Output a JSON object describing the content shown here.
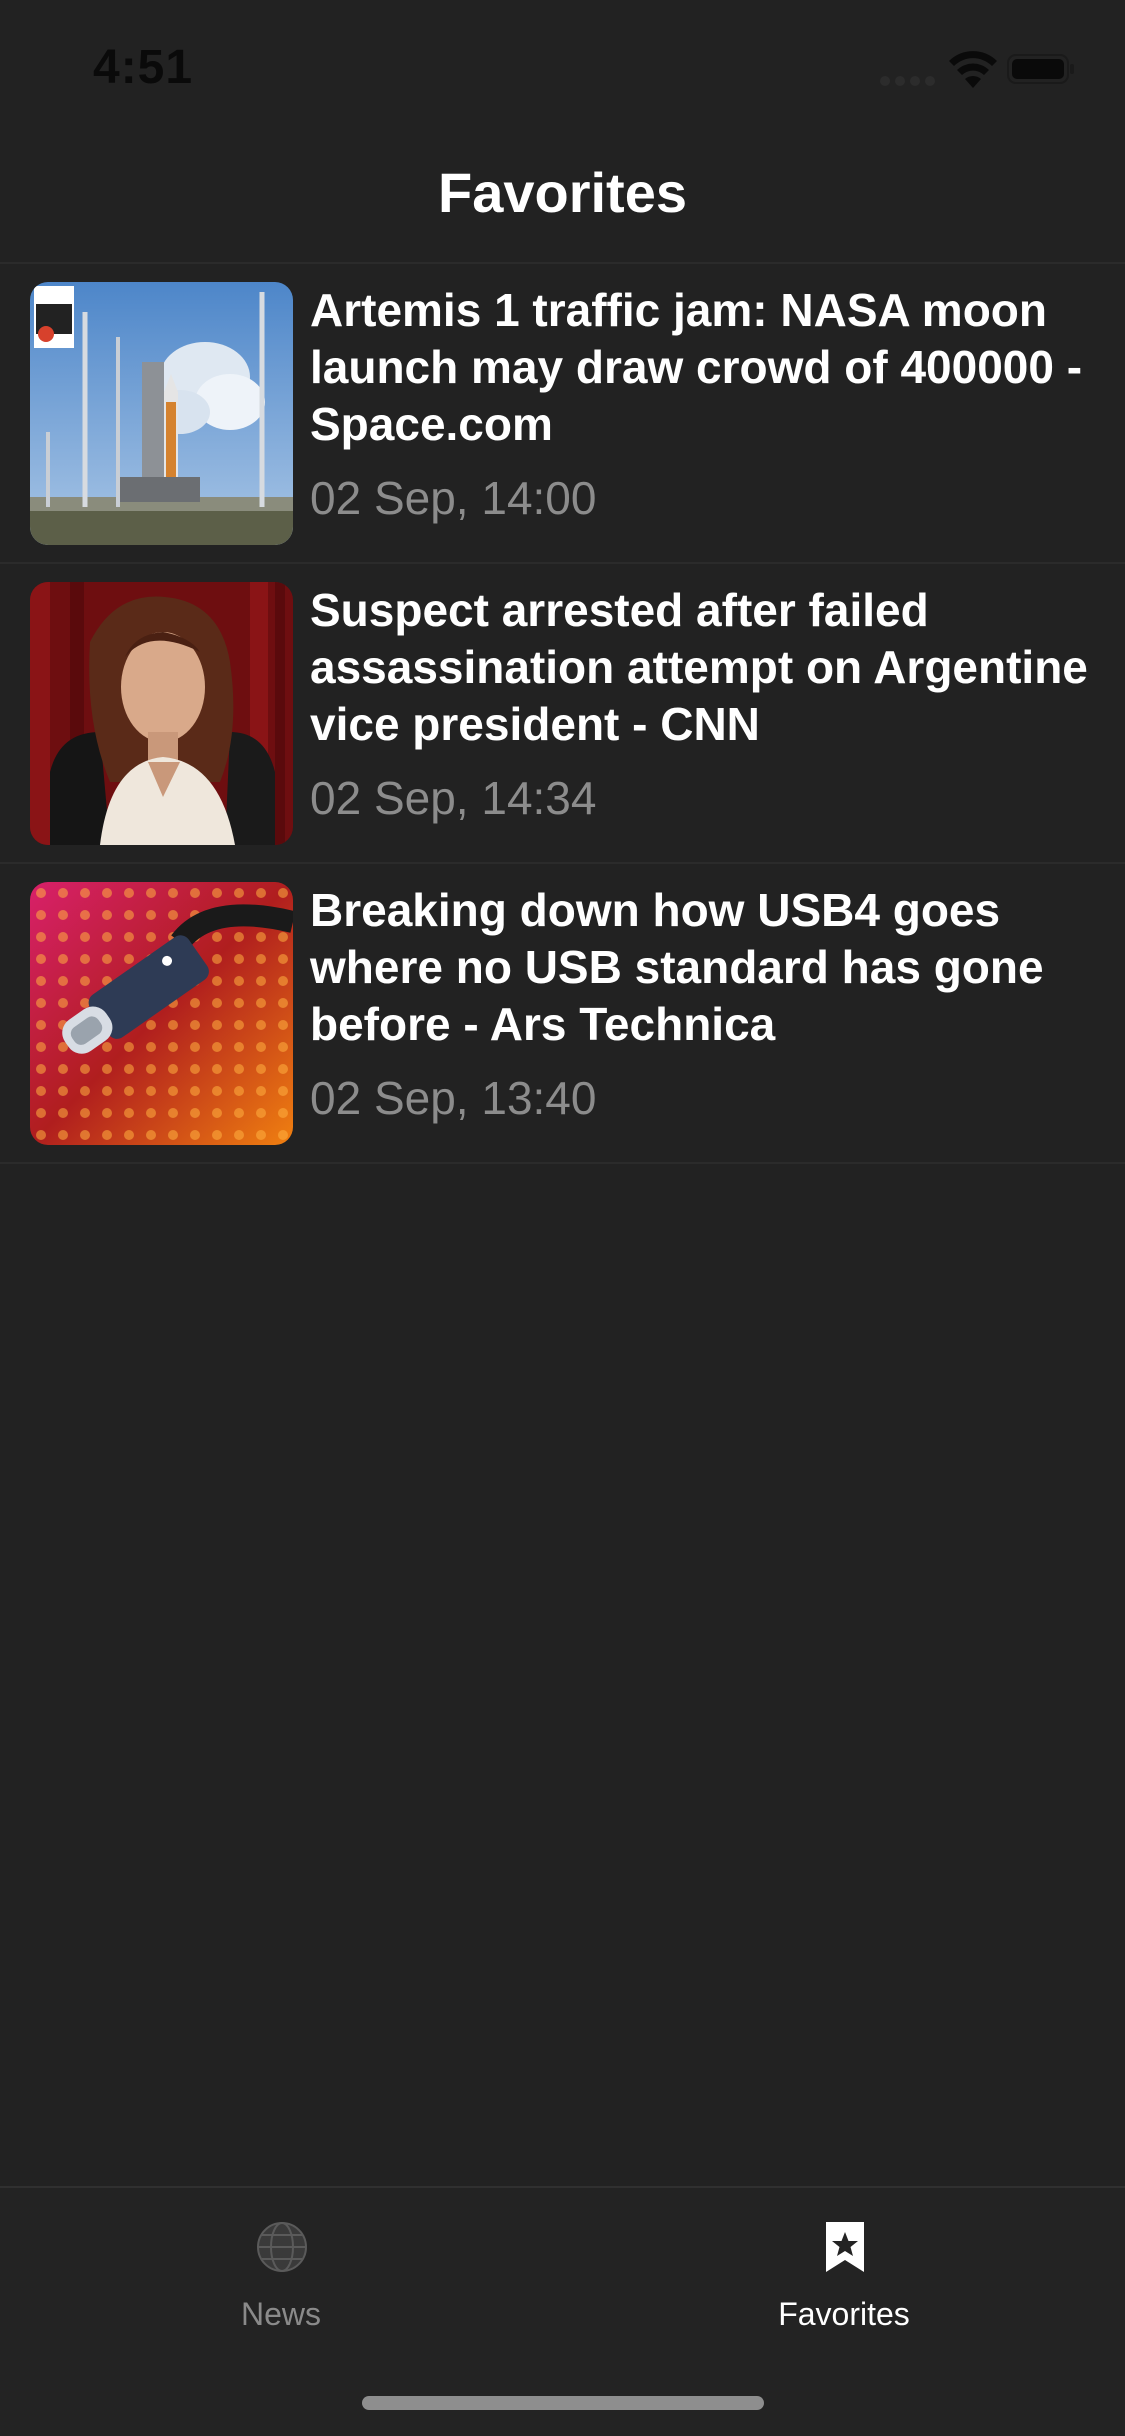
{
  "status_bar": {
    "time": "4:51",
    "icons": [
      "signal-icon",
      "wifi-icon",
      "battery-icon"
    ]
  },
  "nav": {
    "title": "Favorites"
  },
  "articles": [
    {
      "title": "Artemis 1 traffic jam: NASA moon launch may draw crowd of 400000 - Space.com",
      "time": "02 Sep, 14:00",
      "thumbnail": "rocket-launchpad-image"
    },
    {
      "title": "Suspect arrested after failed assassination attempt on Argentine vice president - CNN",
      "time": "02 Sep, 14:34",
      "thumbnail": "vice-president-portrait-image"
    },
    {
      "title": "Breaking down how USB4 goes where no USB standard has gone before - Ars Technica",
      "time": "02 Sep, 13:40",
      "thumbnail": "usb-c-cable-image"
    }
  ],
  "tab_bar": {
    "tabs": [
      {
        "label": "News",
        "icon": "globe-icon",
        "selected": false
      },
      {
        "label": "Favorites",
        "icon": "bookmark-star-icon",
        "selected": true
      }
    ]
  },
  "colors": {
    "background": "#222222",
    "text_primary": "#ffffff",
    "text_secondary": "#8c8c8c",
    "tab_inactive": "#8a8a8a"
  }
}
